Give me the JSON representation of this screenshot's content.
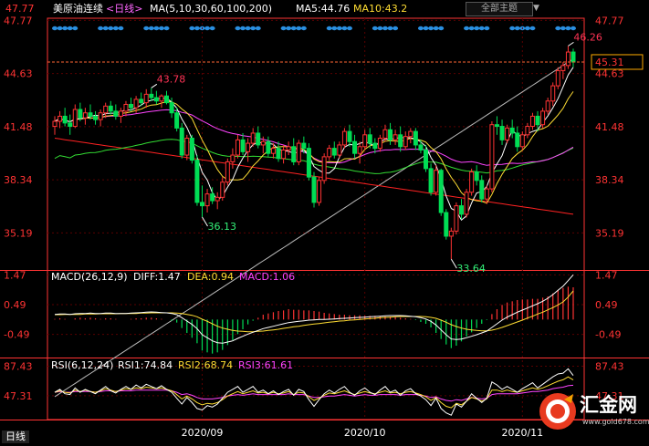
{
  "header": {
    "symbol": "美原油连续",
    "period": "<日线>",
    "ma_params": "MA(5,10,30,60,100,200)",
    "ma5": "MA5:44.76",
    "ma10": "MA10:43.2",
    "theme_button": "全部主题",
    "left_price": "47.77"
  },
  "status": {
    "period": "日线"
  },
  "logo": {
    "text": "汇金网",
    "url": "www.gold678.com"
  },
  "colors": {
    "up": "#ff3333",
    "down": "#00dd55",
    "ma5": "#ffffff",
    "ma10": "#ffdd33",
    "ma30": "#ff44ff",
    "ma60": "#33dd33",
    "ma100": "#ff2222",
    "ma200": "#bbbbbb",
    "axis": "#ff3333",
    "grid": "#5a0000",
    "label_red": "#ff3355",
    "label_green": "#33ee77",
    "dots": "#2a8fe0"
  },
  "chart_data": [
    {
      "type": "candlestick",
      "panel": "price",
      "y_ticks": [
        35.19,
        38.34,
        41.48,
        44.63,
        47.77
      ],
      "ylim": [
        33.0,
        47.9
      ],
      "current_price": 45.31,
      "x_tick_labels": [
        "2020/09",
        "2020/10",
        "2020/11"
      ],
      "x_tick_index": [
        29,
        61,
        92
      ],
      "candles": [
        [
          41.5,
          42.1,
          41.0,
          41.8
        ],
        [
          41.8,
          42.4,
          41.4,
          42.1
        ],
        [
          42.1,
          42.6,
          41.5,
          41.7
        ],
        [
          41.7,
          42.2,
          41.0,
          41.5
        ],
        [
          41.5,
          42.8,
          41.4,
          42.5
        ],
        [
          42.5,
          42.9,
          41.8,
          42.0
        ],
        [
          42.0,
          42.6,
          41.6,
          42.3
        ],
        [
          42.3,
          42.8,
          41.9,
          42.1
        ],
        [
          42.1,
          42.4,
          41.6,
          41.9
        ],
        [
          41.9,
          42.5,
          41.5,
          42.3
        ],
        [
          42.3,
          42.9,
          42.0,
          42.7
        ],
        [
          42.7,
          43.0,
          42.2,
          42.4
        ],
        [
          42.4,
          42.8,
          41.9,
          42.1
        ],
        [
          42.1,
          42.6,
          41.7,
          42.4
        ],
        [
          42.4,
          43.0,
          42.1,
          42.8
        ],
        [
          42.8,
          43.2,
          42.4,
          42.6
        ],
        [
          42.6,
          43.3,
          42.3,
          43.1
        ],
        [
          43.1,
          43.5,
          42.7,
          42.9
        ],
        [
          42.9,
          43.7,
          42.6,
          43.4
        ],
        [
          43.4,
          43.78,
          43.0,
          43.2
        ],
        [
          43.2,
          43.6,
          42.8,
          43.0
        ],
        [
          43.0,
          43.4,
          42.6,
          43.3
        ],
        [
          43.3,
          43.6,
          42.8,
          42.9
        ],
        [
          42.9,
          43.2,
          42.0,
          42.3
        ],
        [
          42.3,
          42.6,
          41.2,
          41.4
        ],
        [
          41.4,
          41.7,
          39.6,
          39.8
        ],
        [
          39.8,
          41.0,
          39.5,
          40.8
        ],
        [
          40.8,
          41.0,
          39.3,
          39.5
        ],
        [
          39.5,
          39.8,
          36.8,
          37.0
        ],
        [
          37.0,
          38.0,
          36.13,
          36.8
        ],
        [
          36.8,
          37.8,
          36.4,
          37.5
        ],
        [
          37.5,
          37.9,
          36.9,
          37.1
        ],
        [
          37.1,
          37.6,
          36.6,
          37.3
        ],
        [
          37.3,
          38.5,
          37.1,
          38.2
        ],
        [
          38.2,
          39.6,
          38.0,
          39.4
        ],
        [
          39.4,
          40.2,
          39.0,
          39.8
        ],
        [
          39.8,
          41.0,
          39.6,
          40.7
        ],
        [
          40.7,
          41.1,
          39.8,
          40.0
        ],
        [
          40.0,
          40.8,
          39.4,
          40.5
        ],
        [
          40.5,
          41.4,
          40.3,
          41.1
        ],
        [
          41.1,
          41.5,
          40.2,
          40.4
        ],
        [
          40.4,
          40.9,
          39.9,
          40.6
        ],
        [
          40.6,
          40.9,
          39.7,
          39.9
        ],
        [
          39.9,
          40.5,
          39.6,
          40.2
        ],
        [
          40.2,
          40.6,
          39.4,
          39.6
        ],
        [
          39.6,
          40.4,
          39.3,
          40.1
        ],
        [
          40.1,
          40.6,
          39.8,
          40.3
        ],
        [
          40.3,
          40.8,
          39.2,
          39.4
        ],
        [
          39.4,
          40.7,
          39.2,
          40.5
        ],
        [
          40.5,
          40.9,
          39.9,
          40.2
        ],
        [
          40.2,
          40.5,
          38.3,
          38.5
        ],
        [
          38.5,
          38.8,
          36.7,
          37.0
        ],
        [
          37.0,
          38.5,
          36.8,
          38.3
        ],
        [
          38.3,
          39.9,
          38.1,
          39.7
        ],
        [
          39.7,
          40.4,
          39.5,
          40.2
        ],
        [
          40.2,
          40.6,
          39.6,
          39.8
        ],
        [
          39.8,
          40.6,
          39.6,
          40.4
        ],
        [
          40.4,
          41.4,
          40.2,
          41.2
        ],
        [
          41.2,
          41.6,
          40.3,
          40.6
        ],
        [
          40.6,
          41.0,
          39.6,
          39.9
        ],
        [
          39.9,
          40.6,
          39.3,
          40.3
        ],
        [
          40.3,
          41.3,
          40.1,
          41.0
        ],
        [
          41.0,
          41.4,
          40.2,
          40.5
        ],
        [
          40.5,
          40.8,
          39.9,
          40.2
        ],
        [
          40.2,
          41.0,
          40.0,
          40.8
        ],
        [
          40.8,
          41.6,
          40.6,
          41.3
        ],
        [
          41.3,
          41.7,
          40.4,
          40.7
        ],
        [
          40.7,
          41.3,
          40.4,
          41.0
        ],
        [
          41.0,
          41.5,
          40.0,
          40.3
        ],
        [
          40.3,
          41.2,
          40.1,
          40.9
        ],
        [
          40.9,
          41.4,
          40.5,
          41.2
        ],
        [
          41.2,
          41.4,
          40.1,
          40.4
        ],
        [
          40.4,
          40.7,
          39.9,
          40.1
        ],
        [
          40.1,
          40.4,
          38.8,
          39.0
        ],
        [
          39.0,
          39.3,
          37.4,
          37.6
        ],
        [
          37.6,
          39.2,
          37.4,
          38.9
        ],
        [
          38.9,
          39.0,
          36.2,
          36.4
        ],
        [
          36.4,
          36.6,
          34.8,
          35.0
        ],
        [
          35.0,
          35.5,
          33.64,
          35.3
        ],
        [
          35.3,
          37.0,
          35.1,
          36.8
        ],
        [
          36.8,
          37.2,
          36.0,
          36.3
        ],
        [
          36.3,
          37.8,
          36.1,
          37.6
        ],
        [
          37.6,
          39.0,
          37.4,
          38.8
        ],
        [
          38.8,
          39.2,
          38.0,
          38.3
        ],
        [
          38.3,
          38.6,
          37.0,
          37.2
        ],
        [
          37.2,
          38.0,
          36.9,
          37.8
        ],
        [
          37.8,
          41.8,
          37.6,
          41.6
        ],
        [
          41.6,
          42.1,
          41.0,
          41.5
        ],
        [
          41.5,
          41.9,
          40.4,
          40.7
        ],
        [
          40.7,
          41.6,
          40.5,
          41.4
        ],
        [
          41.4,
          41.9,
          40.8,
          41.1
        ],
        [
          41.1,
          41.5,
          40.0,
          40.3
        ],
        [
          40.3,
          41.2,
          40.1,
          41.0
        ],
        [
          41.0,
          41.7,
          40.8,
          41.5
        ],
        [
          41.5,
          42.3,
          41.3,
          42.1
        ],
        [
          42.1,
          42.4,
          41.2,
          41.6
        ],
        [
          41.6,
          42.6,
          41.4,
          42.4
        ],
        [
          42.4,
          43.2,
          42.2,
          43.0
        ],
        [
          43.0,
          44.1,
          42.7,
          43.9
        ],
        [
          43.9,
          45.0,
          43.7,
          44.8
        ],
        [
          44.8,
          45.3,
          44.3,
          45.1
        ],
        [
          45.1,
          46.26,
          44.9,
          45.9
        ],
        [
          45.9,
          46.1,
          45.0,
          45.31
        ]
      ],
      "annotations": [
        {
          "text": "43.78",
          "index": 19,
          "value": 43.78,
          "kind": "high"
        },
        {
          "text": "36.13",
          "index": 29,
          "value": 36.13,
          "kind": "low"
        },
        {
          "text": "33.64",
          "index": 78,
          "value": 33.64,
          "kind": "low"
        },
        {
          "text": "46.26",
          "index": 101,
          "value": 46.26,
          "kind": "high"
        }
      ],
      "ma200_points": [
        [
          0,
          38.4
        ],
        [
          20,
          37.0
        ],
        [
          35,
          37.8
        ],
        [
          50,
          39.2
        ],
        [
          70,
          40.4
        ],
        [
          90,
          41.3
        ],
        [
          102,
          41.9
        ]
      ]
    },
    {
      "type": "bar",
      "panel": "macd",
      "title": "MACD(26,12,9)",
      "diff_label": "DIFF:1.47",
      "dea_label": "DEA:0.94",
      "macd_label": "MACD:1.06",
      "y_ticks": [
        -0.49,
        0.49,
        1.47
      ],
      "ylim": [
        -1.25,
        1.6
      ],
      "diff": [
        0.17,
        0.18,
        0.18,
        0.17,
        0.19,
        0.2,
        0.2,
        0.21,
        0.2,
        0.2,
        0.21,
        0.21,
        0.2,
        0.2,
        0.2,
        0.21,
        0.22,
        0.23,
        0.24,
        0.25,
        0.24,
        0.23,
        0.22,
        0.2,
        0.16,
        0.06,
        -0.05,
        -0.16,
        -0.3,
        -0.5,
        -0.6,
        -0.7,
        -0.76,
        -0.78,
        -0.74,
        -0.7,
        -0.62,
        -0.55,
        -0.48,
        -0.42,
        -0.36,
        -0.3,
        -0.26,
        -0.22,
        -0.18,
        -0.14,
        -0.1,
        -0.08,
        -0.06,
        -0.04,
        -0.02,
        -0.01,
        0.0,
        0.0,
        0.01,
        0.02,
        0.03,
        0.04,
        0.05,
        0.06,
        0.07,
        0.08,
        0.09,
        0.1,
        0.11,
        0.12,
        0.13,
        0.13,
        0.13,
        0.12,
        0.11,
        0.09,
        0.06,
        0.02,
        -0.06,
        -0.18,
        -0.34,
        -0.5,
        -0.64,
        -0.66,
        -0.64,
        -0.6,
        -0.55,
        -0.5,
        -0.44,
        -0.38,
        -0.26,
        -0.14,
        -0.02,
        0.08,
        0.16,
        0.24,
        0.31,
        0.38,
        0.45,
        0.52,
        0.6,
        0.7,
        0.82,
        0.96,
        1.1,
        1.28,
        1.47
      ],
      "dea": [
        0.16,
        0.16,
        0.17,
        0.17,
        0.17,
        0.17,
        0.18,
        0.18,
        0.18,
        0.19,
        0.19,
        0.19,
        0.19,
        0.2,
        0.2,
        0.2,
        0.2,
        0.21,
        0.21,
        0.22,
        0.22,
        0.22,
        0.22,
        0.22,
        0.21,
        0.2,
        0.17,
        0.14,
        0.09,
        0.01,
        -0.06,
        -0.14,
        -0.22,
        -0.28,
        -0.32,
        -0.36,
        -0.38,
        -0.39,
        -0.4,
        -0.4,
        -0.39,
        -0.38,
        -0.36,
        -0.34,
        -0.32,
        -0.29,
        -0.27,
        -0.24,
        -0.22,
        -0.19,
        -0.17,
        -0.15,
        -0.13,
        -0.11,
        -0.09,
        -0.07,
        -0.05,
        -0.04,
        -0.02,
        -0.01,
        0.0,
        0.02,
        0.03,
        0.04,
        0.06,
        0.07,
        0.08,
        0.09,
        0.1,
        0.1,
        0.1,
        0.1,
        0.1,
        0.09,
        0.07,
        0.04,
        -0.02,
        -0.09,
        -0.17,
        -0.23,
        -0.28,
        -0.32,
        -0.34,
        -0.36,
        -0.37,
        -0.37,
        -0.35,
        -0.31,
        -0.26,
        -0.2,
        -0.14,
        -0.08,
        -0.02,
        0.05,
        0.11,
        0.18,
        0.24,
        0.32,
        0.39,
        0.48,
        0.58,
        0.74,
        0.94
      ]
    },
    {
      "type": "line",
      "panel": "rsi",
      "title": "RSI(6,12,24)",
      "rsi1_label": "RSI1:74.84",
      "rsi2_label": "RSI2:68.74",
      "rsi3_label": "RSI3:61.61",
      "y_ticks": [
        47.31,
        87.43
      ],
      "ylim": [
        15,
        98
      ],
      "rsi1": [
        52,
        56,
        50,
        49,
        58,
        52,
        56,
        53,
        50,
        55,
        60,
        54,
        51,
        56,
        60,
        56,
        62,
        58,
        63,
        60,
        57,
        61,
        56,
        52,
        44,
        36,
        45,
        38,
        30,
        28,
        34,
        32,
        36,
        44,
        52,
        56,
        60,
        52,
        56,
        60,
        52,
        55,
        50,
        54,
        49,
        53,
        56,
        48,
        56,
        53,
        42,
        33,
        42,
        50,
        55,
        51,
        56,
        60,
        52,
        48,
        54,
        58,
        52,
        49,
        55,
        60,
        52,
        55,
        48,
        54,
        57,
        50,
        47,
        42,
        34,
        44,
        30,
        24,
        21,
        36,
        32,
        40,
        50,
        44,
        38,
        44,
        66,
        62,
        56,
        60,
        56,
        52,
        57,
        61,
        65,
        58,
        63,
        68,
        73,
        77,
        78,
        84,
        74.84
      ],
      "rsi2": [
        52,
        54,
        52,
        51,
        55,
        53,
        55,
        53,
        52,
        54,
        57,
        55,
        53,
        55,
        57,
        56,
        58,
        57,
        59,
        58,
        57,
        58,
        56,
        54,
        49,
        43,
        47,
        43,
        38,
        35,
        37,
        36,
        38,
        42,
        47,
        50,
        53,
        50,
        52,
        54,
        51,
        52,
        50,
        52,
        50,
        51,
        53,
        49,
        52,
        51,
        46,
        41,
        44,
        48,
        51,
        50,
        52,
        54,
        51,
        49,
        51,
        53,
        51,
        50,
        52,
        54,
        51,
        52,
        50,
        52,
        53,
        51,
        49,
        46,
        41,
        45,
        38,
        33,
        31,
        37,
        35,
        40,
        45,
        43,
        40,
        43,
        55,
        55,
        53,
        55,
        53,
        52,
        54,
        56,
        58,
        56,
        58,
        61,
        64,
        67,
        69,
        73,
        68.74
      ],
      "rsi3": [
        52,
        53,
        52,
        52,
        53,
        53,
        53,
        53,
        52,
        53,
        54,
        54,
        53,
        54,
        54,
        54,
        55,
        55,
        55,
        55,
        55,
        55,
        55,
        54,
        52,
        49,
        50,
        48,
        45,
        43,
        43,
        43,
        44,
        45,
        47,
        48,
        49,
        48,
        49,
        50,
        49,
        49,
        49,
        49,
        49,
        49,
        50,
        49,
        49,
        49,
        47,
        45,
        45,
        46,
        47,
        47,
        48,
        49,
        48,
        47,
        48,
        49,
        48,
        48,
        49,
        49,
        49,
        49,
        48,
        49,
        49,
        49,
        48,
        47,
        45,
        46,
        43,
        41,
        40,
        42,
        41,
        43,
        45,
        44,
        43,
        44,
        49,
        50,
        50,
        50,
        50,
        50,
        51,
        52,
        53,
        53,
        54,
        55,
        57,
        58,
        59,
        61,
        61.61
      ]
    }
  ]
}
